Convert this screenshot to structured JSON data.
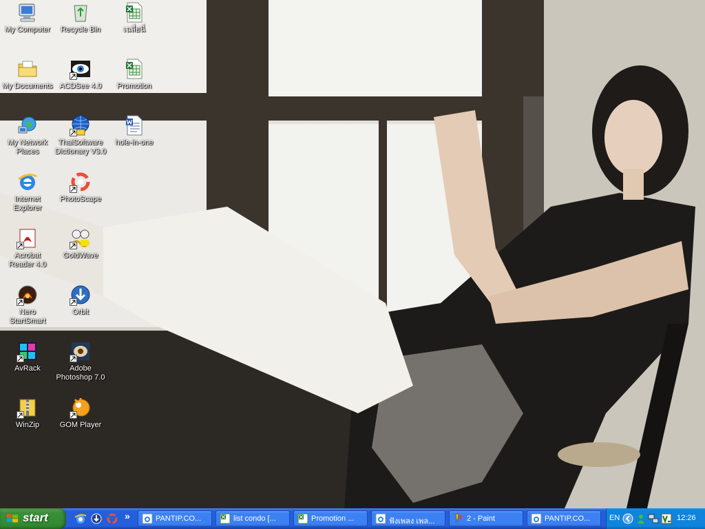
{
  "desktop": {
    "icons": [
      {
        "label": "My Computer"
      },
      {
        "label": "Recycle Bin"
      },
      {
        "label": "เฉลี่ยนี่"
      },
      {
        "label": "My Documents"
      },
      {
        "label": "ACDSee 4.0"
      },
      {
        "label": "Promotion"
      },
      {
        "label": "My Network Places"
      },
      {
        "label": "ThaiSoftware Dictionary V3.0"
      },
      {
        "label": "hole-in-one"
      },
      {
        "label": "Internet Explorer"
      },
      {
        "label": "PhotoScape"
      },
      {
        "label": "Acrobat Reader 4.0"
      },
      {
        "label": "GoldWave"
      },
      {
        "label": "Nero StartSmart"
      },
      {
        "label": "Orbit"
      },
      {
        "label": "AvRack"
      },
      {
        "label": "Adobe Photoshop 7.0"
      },
      {
        "label": "WinZip"
      },
      {
        "label": "GOM Player"
      }
    ]
  },
  "taskbar": {
    "start_label": "start",
    "overflow_label": "»",
    "buttons": [
      {
        "label": "PANTIP.CO..."
      },
      {
        "label": "list condo [..."
      },
      {
        "label": "Promotion ..."
      },
      {
        "label": "ฟังเพลง เพล..."
      },
      {
        "label": "2 - Paint"
      },
      {
        "label": "PANTIP.CO..."
      }
    ],
    "tray": {
      "language": "EN",
      "clock": "12:26"
    }
  },
  "colors": {
    "taskbar_blue": "#245edb",
    "start_green": "#3c8f3b",
    "tray_blue": "#0f84dc"
  }
}
